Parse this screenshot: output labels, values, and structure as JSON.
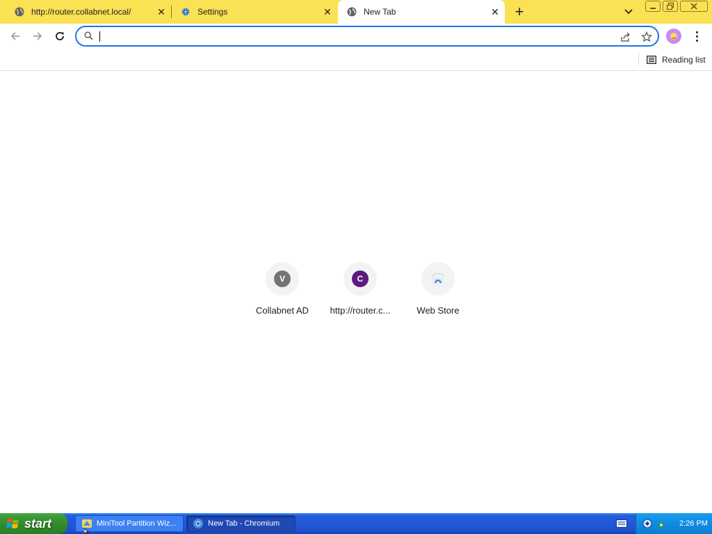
{
  "tabs": [
    {
      "title": "http://router.collabnet.local/",
      "icon": "globe-icon",
      "active": false
    },
    {
      "title": "Settings",
      "icon": "gear-icon",
      "active": false
    },
    {
      "title": "New Tab",
      "icon": "globe-icon",
      "active": true
    }
  ],
  "tab_close_glyph": "✕",
  "new_tab_glyph": "+",
  "omnibox": {
    "value": "",
    "placeholder": ""
  },
  "bookmarks_bar": {
    "reading_list_label": "Reading list"
  },
  "shortcuts": [
    {
      "letter": "V",
      "label": "Collabnet AD",
      "color": "#757575"
    },
    {
      "letter": "C",
      "label": "http://router.c...",
      "color": "#5c1a7d"
    },
    {
      "letter": "",
      "label": "Web Store",
      "icon": "web-store-icon"
    }
  ],
  "taskbar": {
    "start_label": "start",
    "tasks": [
      {
        "label": "MiniTool Partition Wiz...",
        "icon": "minitool-icon",
        "active": false
      },
      {
        "label": "New Tab - Chromium",
        "icon": "chromium-icon",
        "active": true
      }
    ],
    "clock": "2:26 PM"
  },
  "colors": {
    "tabstrip": "#fbe154",
    "omnibox_focus": "#1a73e8",
    "taskbar": "#245edb",
    "start_button": "#3c9a37"
  }
}
